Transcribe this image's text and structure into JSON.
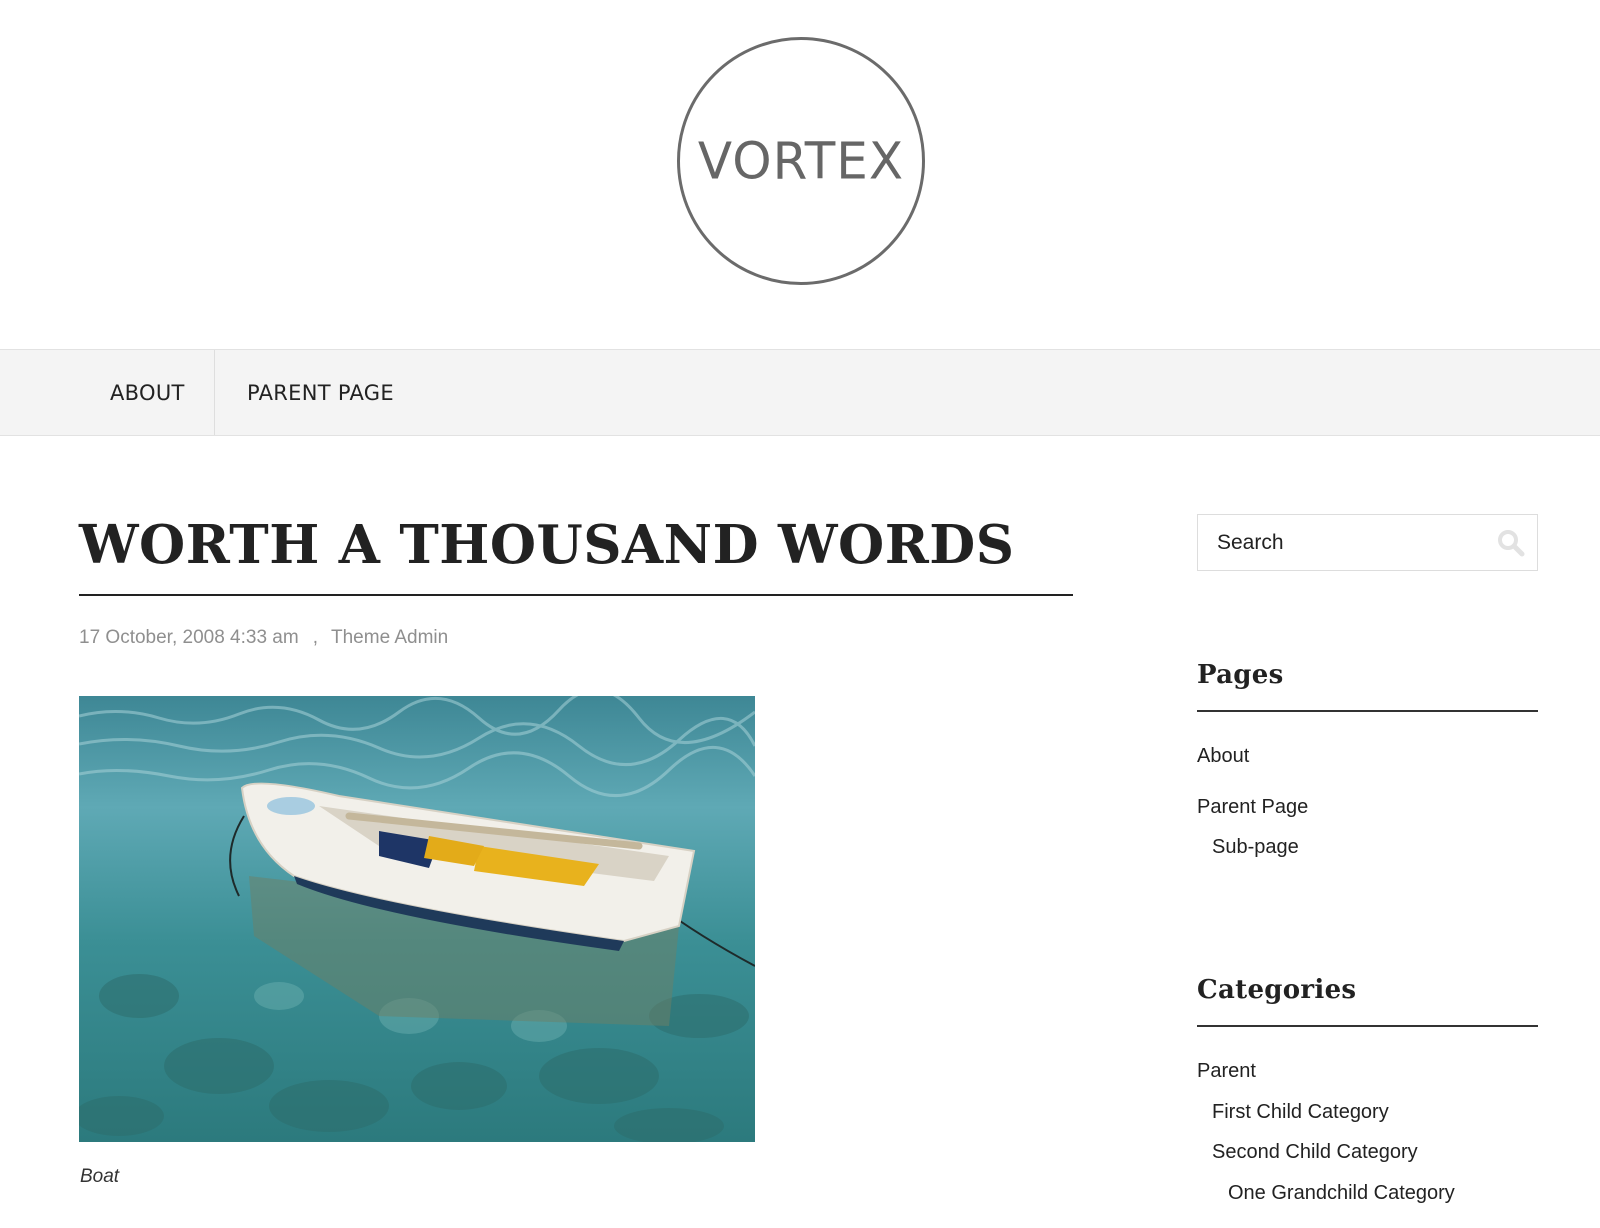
{
  "site": {
    "logo_text": "VORTEX"
  },
  "nav": {
    "items": [
      {
        "label": "ABOUT"
      },
      {
        "label": "PARENT PAGE"
      }
    ]
  },
  "post": {
    "title": "WORTH A THOUSAND WORDS",
    "date": "17 October, 2008 4:33 am",
    "separator": ",",
    "author": "Theme Admin",
    "image_caption": "Boat"
  },
  "sidebar": {
    "search": {
      "placeholder": "Search"
    },
    "pages": {
      "title": "Pages",
      "items": [
        {
          "label": "About"
        },
        {
          "label": "Parent Page"
        },
        {
          "label": "Sub-page"
        }
      ]
    },
    "categories": {
      "title": "Categories",
      "items": [
        {
          "label": "Parent"
        },
        {
          "label": "First Child Category"
        },
        {
          "label": "Second Child Category"
        },
        {
          "label": "One Grandchild Category"
        }
      ]
    }
  }
}
